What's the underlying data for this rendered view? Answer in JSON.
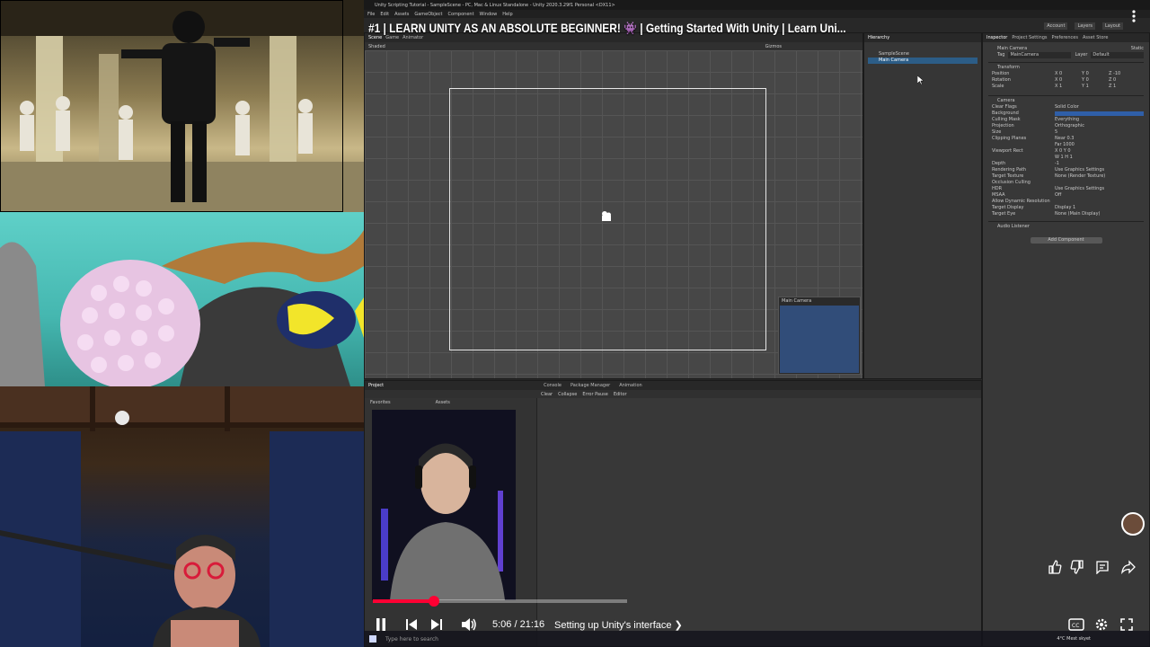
{
  "video": {
    "title": "#1 | LEARN UNITY AS AN ABSOLUTE BEGINNER! 👾 | Getting Started With Unity | Learn Uni...",
    "time": "5:06 / 21:16",
    "chapter": "Setting up Unity's interface ❯",
    "progress_fraction": 0.24
  },
  "unity": {
    "window_title": "Unity Scripting Tutorial - SampleScene - PC, Mac & Linux Standalone - Unity 2020.3.29f1 Personal <DX11>",
    "menu": [
      "File",
      "Edit",
      "Assets",
      "GameObject",
      "Component",
      "Window",
      "Help"
    ],
    "top_right": [
      "Account",
      "Layers",
      "Layout"
    ],
    "scene_tabs": [
      "Scene",
      "Game",
      "Animator"
    ],
    "shaded": "Shaded",
    "gizmos": "Gizmos",
    "hierarchy": {
      "tab": "Hierarchy",
      "items": [
        "SampleScene",
        "Main Camera"
      ]
    },
    "inspector": {
      "tabs": [
        "Inspector",
        "Project Settings",
        "Preferences",
        "Asset Store"
      ],
      "object_name": "Main Camera",
      "static": "Static",
      "tag_label": "Tag",
      "tag_value": "MainCamera",
      "layer_label": "Layer",
      "layer_value": "Default",
      "transform_header": "Transform",
      "transform_rows": [
        {
          "label": "Position",
          "x": "0",
          "y": "0",
          "z": "-10"
        },
        {
          "label": "Rotation",
          "x": "0",
          "y": "0",
          "z": "0"
        },
        {
          "label": "Scale",
          "x": "1",
          "y": "1",
          "z": "1"
        }
      ],
      "camera_header": "Camera",
      "camera_rows": [
        {
          "label": "Clear Flags",
          "value": "Solid Color"
        },
        {
          "label": "Background",
          "value": ""
        },
        {
          "label": "Culling Mask",
          "value": "Everything"
        },
        {
          "label": "Projection",
          "value": "Orthographic"
        },
        {
          "label": "Size",
          "value": "5"
        },
        {
          "label": "Clipping Planes",
          "value": "Near 0.3"
        },
        {
          "label": "",
          "value": "Far 1000"
        },
        {
          "label": "Viewport Rect",
          "value": "X 0   Y 0"
        },
        {
          "label": "",
          "value": "W 1   H 1"
        },
        {
          "label": "Depth",
          "value": "-1"
        },
        {
          "label": "Rendering Path",
          "value": "Use Graphics Settings"
        },
        {
          "label": "Target Texture",
          "value": "None (Render Texture)"
        },
        {
          "label": "Occlusion Culling",
          "value": ""
        },
        {
          "label": "HDR",
          "value": "Use Graphics Settings"
        },
        {
          "label": "MSAA",
          "value": "Off"
        },
        {
          "label": "Allow Dynamic Resolution",
          "value": ""
        },
        {
          "label": "Target Display",
          "value": "Display 1"
        },
        {
          "label": "Target Eye",
          "value": "None (Main Display)"
        }
      ],
      "audio_listener": "Audio Listener",
      "add_component": "Add Component"
    },
    "camera_preview_label": "Main Camera",
    "bottom_tabs": [
      "Project",
      "Console",
      "Package Manager",
      "Animation"
    ],
    "console_buttons": [
      "Clear",
      "Collapse",
      "Error Pause",
      "Editor"
    ],
    "project": {
      "favorites": "Favorites",
      "assets": "Assets"
    }
  },
  "taskbar": {
    "search_placeholder": "Type here to search",
    "weather": "4°C  Mest skyet"
  }
}
